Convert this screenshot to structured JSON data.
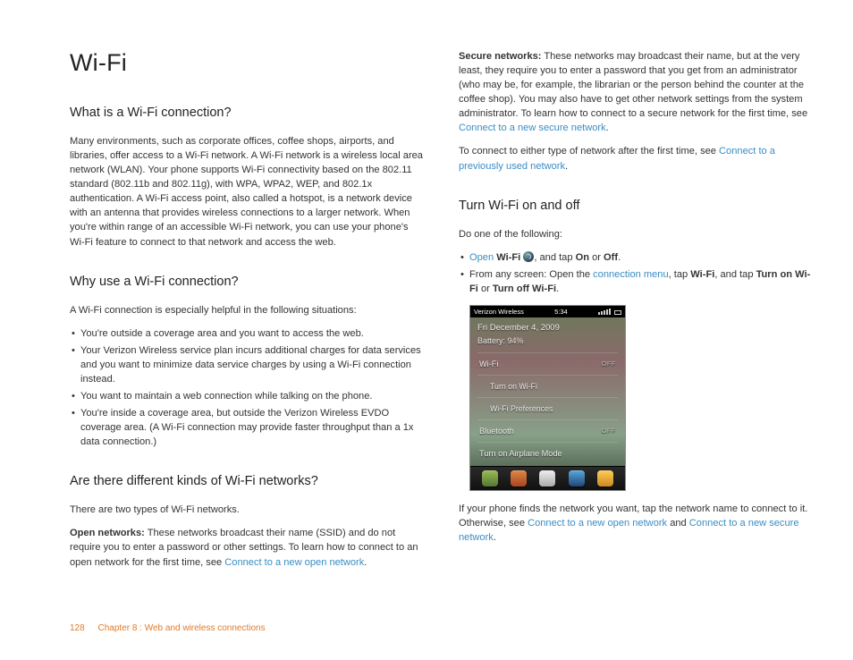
{
  "title": "Wi-Fi",
  "left": {
    "h_what": "What is a Wi-Fi connection?",
    "p_what": "Many environments, such as corporate offices, coffee shops, airports, and libraries, offer access to a Wi-Fi network. A Wi-Fi network is a wireless local area network (WLAN). Your phone supports Wi-Fi connectivity based on the 802.11 standard (802.11b and 802.11g), with WPA, WPA2, WEP, and 802.1x authentication. A Wi-Fi access point, also called a hotspot, is a network device with an antenna that provides wireless connections to a larger network. When you're within range of an accessible Wi-Fi network, you can use your phone's Wi-Fi feature to connect to that network and access the web.",
    "h_why": "Why use a Wi-Fi connection?",
    "p_why": "A Wi-Fi connection is especially helpful in the following situations:",
    "why_items": [
      "You're outside a coverage area and you want to access the web.",
      "Your Verizon Wireless service plan incurs additional charges for data services and you want to minimize data service charges by using a Wi-Fi connection instead.",
      "You want to maintain a web connection while talking on the phone.",
      "You're inside a coverage area, but outside the Verizon Wireless EVDO coverage area. (A Wi-Fi connection may provide faster throughput than a 1x data connection.)"
    ],
    "h_kinds": "Are there different kinds of Wi-Fi networks?",
    "p_kinds": "There are two types of Wi-Fi networks.",
    "open_b": "Open networks:",
    "open_t": " These networks broadcast their name (SSID) and do not require you to enter a password or other settings. To learn how to connect to an open network for the first time, see ",
    "open_link": "Connect to a new open network"
  },
  "right": {
    "sec_b": "Secure networks:",
    "sec_t": " These networks may broadcast their name, but at the very least, they require you to enter a password that you get from an administrator (who may be, for example, the librarian or the person behind the counter at the coffee shop). You may also have to get other network settings from the system administrator. To learn how to connect to a secure network for the first time, see ",
    "sec_link": "Connect to a new secure network",
    "either_a": "To connect to either type of network after the first time, see ",
    "either_link": "Connect to a previously used network",
    "h_turn": "Turn Wi-Fi on and off",
    "p_do": "Do one of the following:",
    "b1_open": "Open",
    "b1_wifi": "Wi-Fi",
    "b1_tap": ", and tap ",
    "b1_on": "On",
    "b1_or": " or ",
    "b1_off": "Off",
    "b2_a": "From any screen: Open the ",
    "b2_link": "connection menu",
    "b2_b": ", tap ",
    "b2_wifi": "Wi-Fi",
    "b2_c": ", and tap ",
    "b2_turnon": "Turn on Wi-Fi",
    "b2_or": " or ",
    "b2_turnoff": "Turn off Wi-Fi",
    "after_a": "If your phone finds the network you want, tap the network name to connect to it. Otherwise, see ",
    "after_l1": "Connect to a new open network",
    "after_and": " and ",
    "after_l2": "Connect to a new secure network"
  },
  "phone": {
    "carrier": "Verizon Wireless",
    "time": "5:34",
    "date": "Fri December 4, 2009",
    "battery": "Battery: 94%",
    "r_wifi": "Wi-Fi",
    "r_wifi_state": "OFF",
    "r_turn_wifi": "Turn on Wi-Fi",
    "r_wifi_pref": "Wi-Fi Preferences",
    "r_bt": "Bluetooth",
    "r_bt_state": "OFF",
    "r_airplane": "Turn on Airplane Mode"
  },
  "footer": {
    "page": "128",
    "chapter": "Chapter 8  :  Web and wireless connections"
  }
}
